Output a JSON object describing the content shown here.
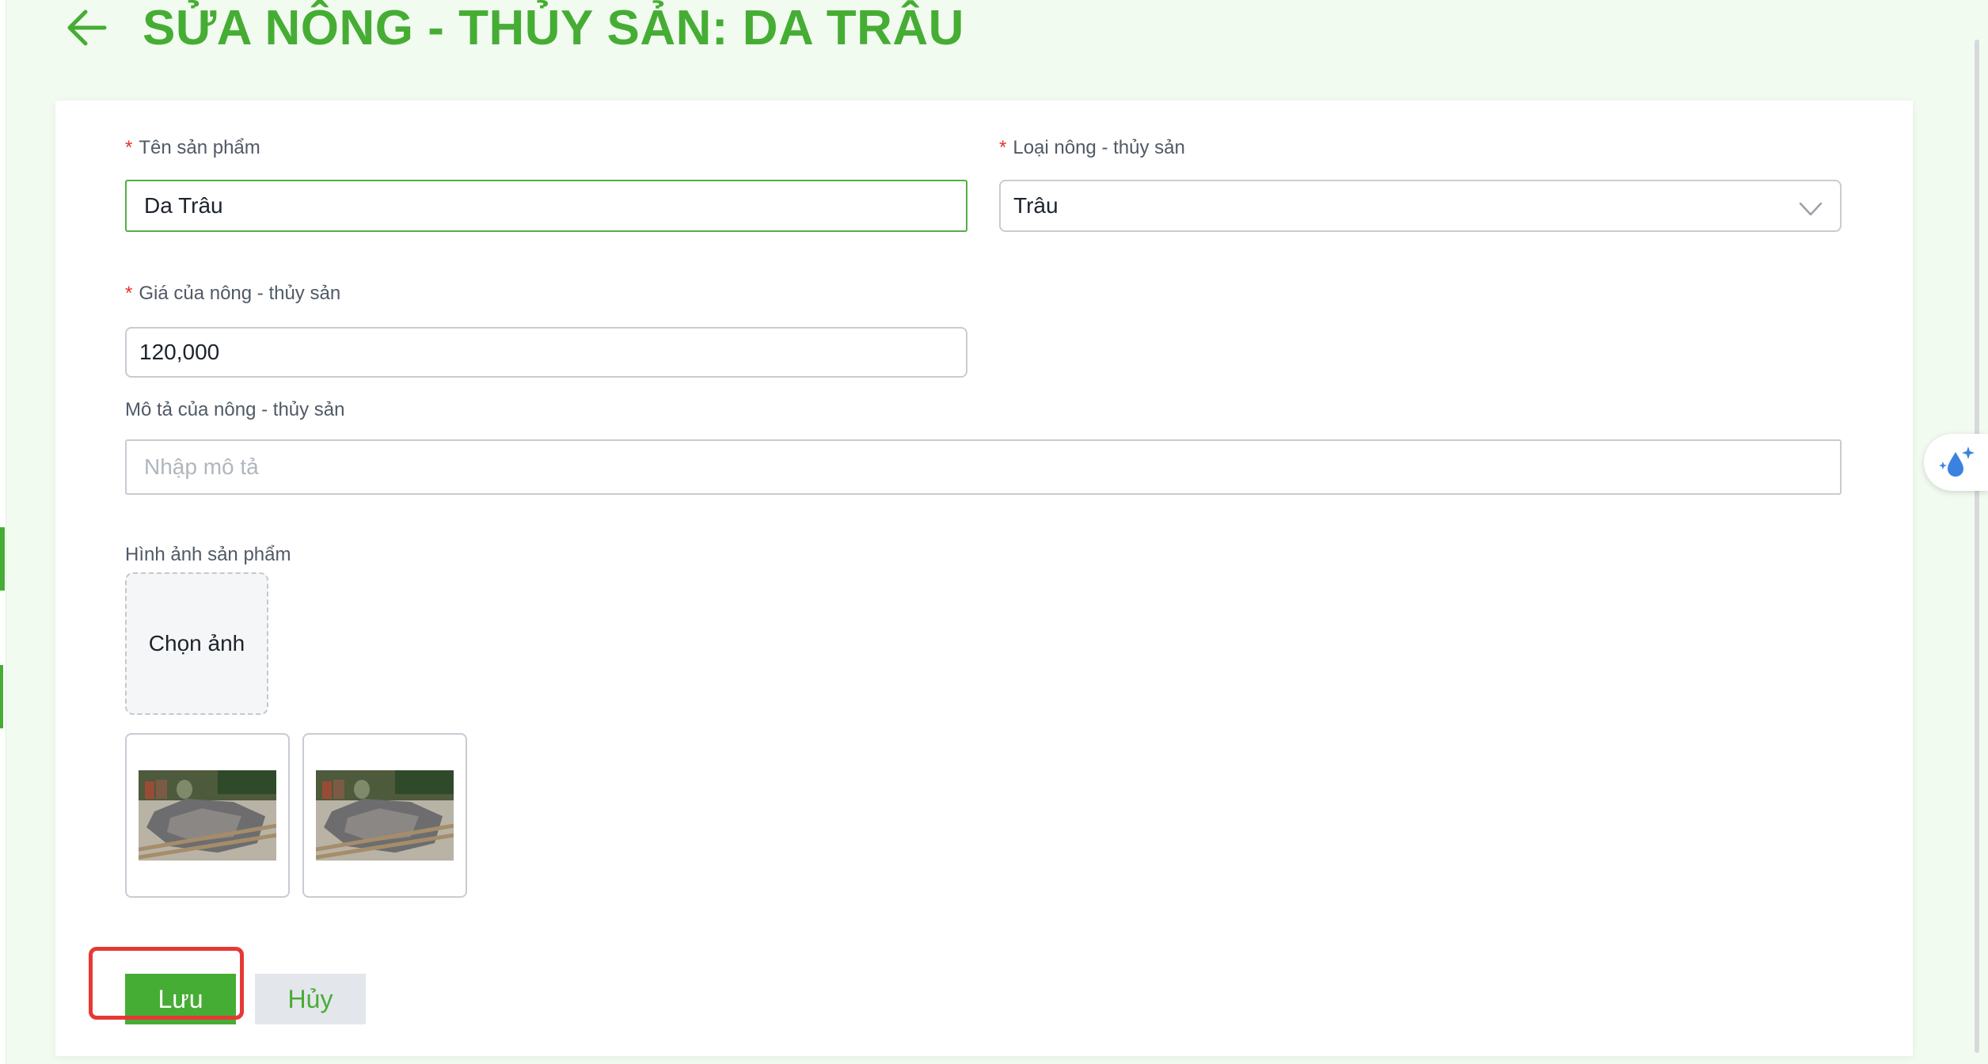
{
  "page": {
    "title": "SỬA NÔNG - THỦY SẢN: DA TRÂU"
  },
  "form": {
    "product_name": {
      "required_mark": "*",
      "label": "Tên sản phẩm",
      "value": "Da Trâu"
    },
    "product_type": {
      "required_mark": "*",
      "label": "Loại nông - thủy sản",
      "value": "Trâu"
    },
    "price": {
      "required_mark": "*",
      "label": "Giá của nông - thủy sản",
      "value": "120,000"
    },
    "description": {
      "label": "Mô tả của nông - thủy sản",
      "placeholder": "Nhập mô tả"
    },
    "images": {
      "label": "Hình ảnh sản phẩm",
      "upload_label": "Chọn ảnh",
      "thumbnail_count": 2
    }
  },
  "actions": {
    "save_label": "Lưu",
    "cancel_label": "Hủy"
  },
  "colors": {
    "accent": "#46ad34",
    "required": "#e5332a",
    "highlight": "#e53935"
  },
  "icons": {
    "back": "arrow-left-icon",
    "select": "chevron-down-icon",
    "floating": "water-drop-sparkle-icon"
  }
}
